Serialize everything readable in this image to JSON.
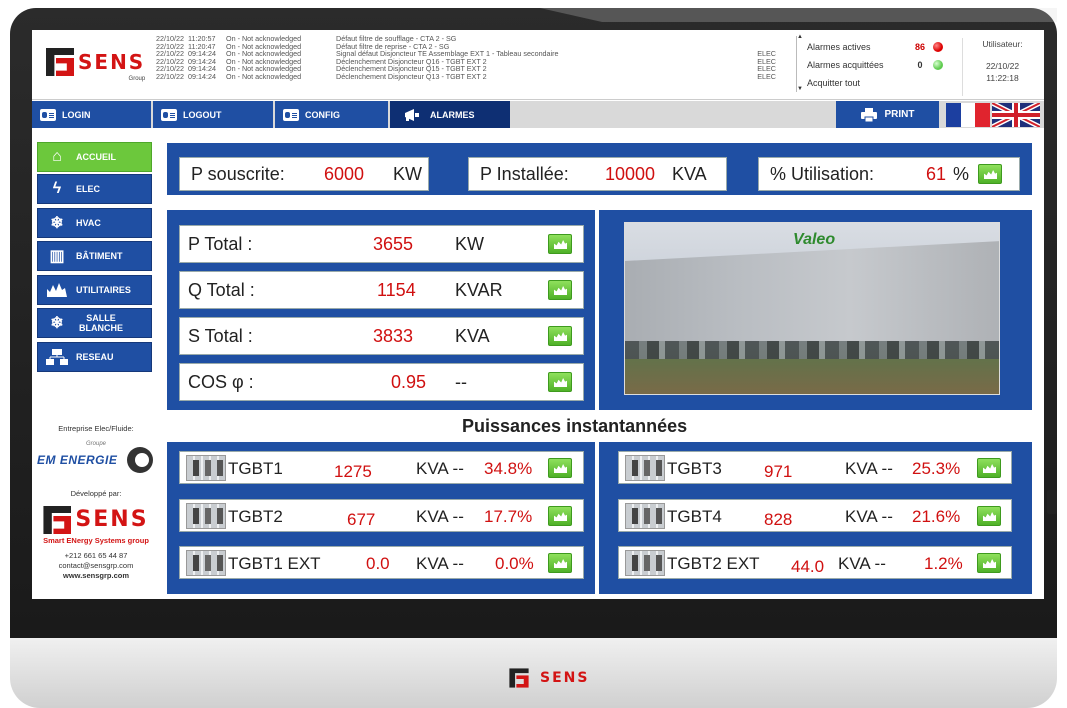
{
  "header": {
    "logo_text": "SENS",
    "logo_sub": "Group",
    "log": [
      {
        "date": "22/10/22",
        "time": "11:20:57",
        "status": "On - Not acknowledged",
        "message": "Défaut filtre de soufflage - CTA 2 - SG",
        "zone": ""
      },
      {
        "date": "22/10/22",
        "time": "11:20:47",
        "status": "On - Not acknowledged",
        "message": "Défaut filtre de reprise - CTA 2 - SG",
        "zone": ""
      },
      {
        "date": "22/10/22",
        "time": "09:14:24",
        "status": "On - Not acknowledged",
        "message": "Signal défaut Disjoncteur TE Assemblage EXT 1 - Tableau secondaire",
        "zone": "ELEC"
      },
      {
        "date": "22/10/22",
        "time": "09:14:24",
        "status": "On - Not acknowledged",
        "message": "Déclenchement Disjoncteur  Q16 - TGBT EXT 2",
        "zone": "ELEC"
      },
      {
        "date": "22/10/22",
        "time": "09:14:24",
        "status": "On - Not acknowledged",
        "message": "Déclenchement Disjoncteur  Q15 - TGBT EXT 2",
        "zone": "ELEC"
      },
      {
        "date": "22/10/22",
        "time": "09:14:24",
        "status": "On - Not acknowledged",
        "message": "Déclenchement Disjoncteur  Q13 - TGBT EXT 2",
        "zone": "ELEC"
      }
    ],
    "alarms": {
      "active_label": "Alarmes actives",
      "active_count": "86",
      "acked_label": "Alarmes acquittées",
      "acked_count": "0",
      "ack_all_label": "Acquitter tout"
    },
    "user": {
      "label": "Utilisateur:",
      "date": "22/10/22",
      "time": "11:22:18"
    }
  },
  "nav": {
    "login": "LOGIN",
    "logout": "LOGOUT",
    "config": "CONFIG",
    "alarmes": "ALARMES",
    "print": "PRINT"
  },
  "sidebar": {
    "items": [
      {
        "label": "ACCUEIL",
        "icon": "home-icon"
      },
      {
        "label": "ELEC",
        "icon": "lightning-icon"
      },
      {
        "label": "HVAC",
        "icon": "snowflake-icon"
      },
      {
        "label": "BÂTIMENT",
        "icon": "building-icon"
      },
      {
        "label": "UTILITAIRES",
        "icon": "chart-icon"
      },
      {
        "label": "SALLE BLANCHE",
        "icon": "snowflake-icon"
      },
      {
        "label": "RESEAU",
        "icon": "network-icon"
      }
    ],
    "company_label": "Entreprise Elec/Fluide:",
    "em_groupe": "Groupe",
    "em_name": "EM ENERGIE",
    "dev_label": "Développé par:",
    "tagline": "Smart ENergy Systems group",
    "phone": "+212 661 65 44 87",
    "email": "contact@sensgrp.com",
    "web": "www.sensgrp.com"
  },
  "summary": {
    "p_souscrite_label": "P souscrite:",
    "p_souscrite_value": "6000",
    "p_souscrite_unit": "KW",
    "p_installee_label": "P Installée:",
    "p_installee_value": "10000",
    "p_installee_unit": "KVA",
    "utilisation_label": "% Utilisation:",
    "utilisation_value": "61",
    "utilisation_unit": "%"
  },
  "totals": [
    {
      "label": "P Total :",
      "value": "3655",
      "unit": "KW"
    },
    {
      "label": "Q Total :",
      "value": "1154",
      "unit": "KVAR"
    },
    {
      "label": "S Total :",
      "value": "3833",
      "unit": "KVA"
    },
    {
      "label": "COS φ :",
      "value": "0.95",
      "unit": "--"
    }
  ],
  "photo_brand": "Valeo",
  "section_title": "Puissances instantannées",
  "tgbt": [
    {
      "name": "TGBT1",
      "value": "1275",
      "unit": "KVA --",
      "pct": "34.8%"
    },
    {
      "name": "TGBT2",
      "value": "677",
      "unit": "KVA --",
      "pct": "17.7%"
    },
    {
      "name": "TGBT1 EXT",
      "value": "0.0",
      "unit": "KVA --",
      "pct": "0.0%"
    },
    {
      "name": "TGBT3",
      "value": "971",
      "unit": "KVA --",
      "pct": "25.3%"
    },
    {
      "name": "TGBT4",
      "value": "828",
      "unit": "KVA --",
      "pct": "21.6%"
    },
    {
      "name": "TGBT2 EXT",
      "value": "44.0",
      "unit": "KVA --",
      "pct": "1.2%"
    }
  ],
  "chin_logo": "SENS",
  "colors": {
    "accent_blue": "#1f4fa3",
    "active_green": "#6cc83c",
    "value_red": "#d01010",
    "brand_red": "#d31414"
  }
}
